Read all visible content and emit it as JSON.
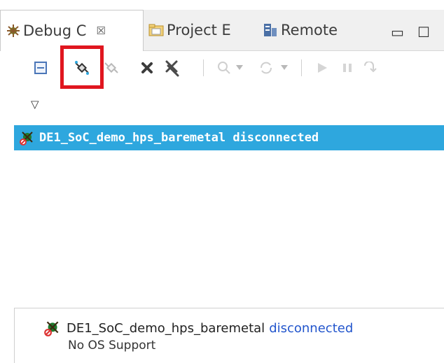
{
  "tabs": [
    {
      "label": "Debug C",
      "close": "☒"
    },
    {
      "label": "Project E"
    },
    {
      "label": "Remote"
    }
  ],
  "window_buttons": {
    "minimize": "▭",
    "maximize": "☐"
  },
  "toolbar": {
    "view_menu_glyph": "▽"
  },
  "debug_tree": {
    "items": [
      {
        "label": "DE1_SoC_demo_hps_baremetal disconnected",
        "selected": true
      }
    ]
  },
  "details": {
    "name": "DE1_SoC_demo_hps_baremetal",
    "status": "disconnected",
    "os": "No OS Support"
  },
  "colors": {
    "selection": "#2ea7de",
    "highlight_box": "#e0161f",
    "status_link": "#2255cc"
  }
}
